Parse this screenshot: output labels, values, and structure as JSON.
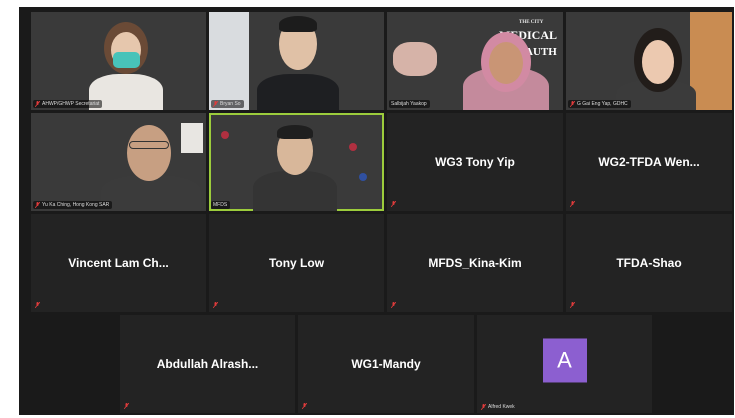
{
  "colors": {
    "stage_bg": "#1a1a1a",
    "tile_bg": "#232323",
    "active_speaker": "#9ccc3c",
    "muted_mic": "#e03b3b",
    "avatar_bg": "#8c5fd0"
  },
  "video_tiles": [
    {
      "label": "AHWP/GHWP Secretariat"
    },
    {
      "label": "Bryan So"
    },
    {
      "label": "Salbijah Yaakop"
    },
    {
      "label": "G Gai Eng Yap, GDHC"
    },
    {
      "label": "Yu Ka Ching, Hong Kong SAR"
    },
    {
      "label": "MFDS"
    }
  ],
  "sign_text": {
    "line1": "THE CITY",
    "line2": "MEDICAL",
    "line3": "AUTH"
  },
  "name_tiles": [
    {
      "name": "WG3 Tony Yip"
    },
    {
      "name": "WG2-TFDA  Wen..."
    },
    {
      "name": "Vincent  Lam  Ch..."
    },
    {
      "name": "Tony Low"
    },
    {
      "name": "MFDS_Kina-Kim"
    },
    {
      "name": "TFDA-Shao"
    },
    {
      "name": "Abdullah  Alrash..."
    },
    {
      "name": "WG1-Mandy"
    }
  ],
  "avatar_tile": {
    "initial": "A",
    "label": "Alfred Kwek"
  },
  "icons": {
    "muted": "mic-muted-icon"
  }
}
